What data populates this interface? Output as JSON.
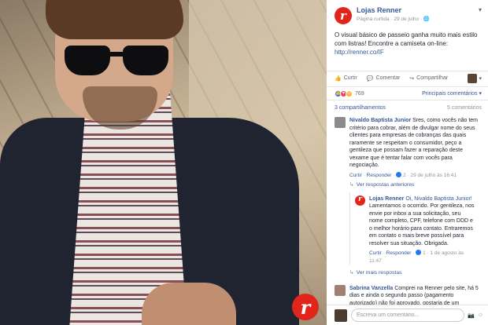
{
  "post": {
    "page_name": "Lojas Renner",
    "sub_line": "Página curtida · 29 de julho · ",
    "more": "▾",
    "text_before_link": "O visual básico de passeio ganha muito mais estilo com listras! Encontre a camiseta on-line: ",
    "link": "http://renner.co/IF"
  },
  "actions": {
    "like": "Curtir",
    "comment": "Comentar",
    "share": "Compartilhar",
    "audience": "▾"
  },
  "reactions": {
    "count": "769",
    "relevance": "Principais comentários ▾"
  },
  "shares": {
    "left": "3 compartilhamentos",
    "right": "5 comentários"
  },
  "comments": [
    {
      "name": "Nivaldo Baptista Junior",
      "text": " Sres, como vocês não tem critério para cobrar, além de divulgar nome do seus clientes para empresas de cobranças das quais raramente se respeitam o consumidor, peço a gentileza que possam fazer a reparação deste vexame que é tentar falar com vocês para negociação.",
      "like": "Curtir",
      "reply": "Responder",
      "likes": "2",
      "time": "29 de julho às 16:41",
      "more_link": "Ver respostas anteriores"
    },
    {
      "name": "Sabrina Vanzella",
      "text": " Comprei na Renner pelo site, há 5 dias e ainda o segundo passo (pagamento autorizado) não foi aprovado, gostaria de um"
    }
  ],
  "reply": {
    "name": "Lojas Renner",
    "mention": "Oi, Nivaldo Baptista Junior!",
    "text": " Lamentamos o ocorrido. Por gentileza, nos envie por inbox a sua solicitação, seu nome completo, CPF, telefone com DDD e o melhor horário para contato. Entraremos em contato o mais breve possível para resolver sua situação. Obrigada.",
    "like": "Curtir",
    "reply": "Responder",
    "likes": "1",
    "time": "1 de agosto às 11:47",
    "more_link": "Ver mais respostas"
  },
  "composer": {
    "placeholder": "Escreva um comentário..."
  }
}
